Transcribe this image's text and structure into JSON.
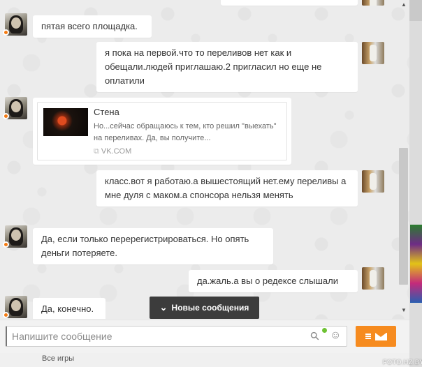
{
  "messages": {
    "m1": "пятая всего площадка.",
    "m2": "я пока на первой.что то переливов нет как и обещали.людей приглашаю.2 пригласил но еще не оплатили",
    "m4": "класс.вот я работаю.а вышестоящий нет.ему переливы а мне дуля с маком.а спонсора нельзя менять",
    "m5": "Да, если только перерегистрироваться. Но опять деньги потеряете.",
    "m6": "да.жаль.а вы о редексе слышали",
    "m7": "Да, конечно."
  },
  "link_card": {
    "title": "Стена",
    "description": "Но...сейчас обращаюсь к тем, кто решил \"выехать\" на переливах. Да, вы получите...",
    "source": "VK.COM"
  },
  "new_messages_label": "Новые сообщения",
  "composer": {
    "placeholder": "Напишите сообщение"
  },
  "footer": {
    "all_games": "Все игры",
    "watermark": "FOTO.HZ.BY"
  },
  "icons": {
    "attach": "paperclip-icon",
    "emoji": "smile-icon",
    "send": "send-envelope-icon",
    "chevron": "chevron-down-icon"
  },
  "colors": {
    "accent": "#f68b1f",
    "online": "#f37a12",
    "attach_indicator": "#6ec233",
    "toast_bg": "#3c3c3c"
  }
}
